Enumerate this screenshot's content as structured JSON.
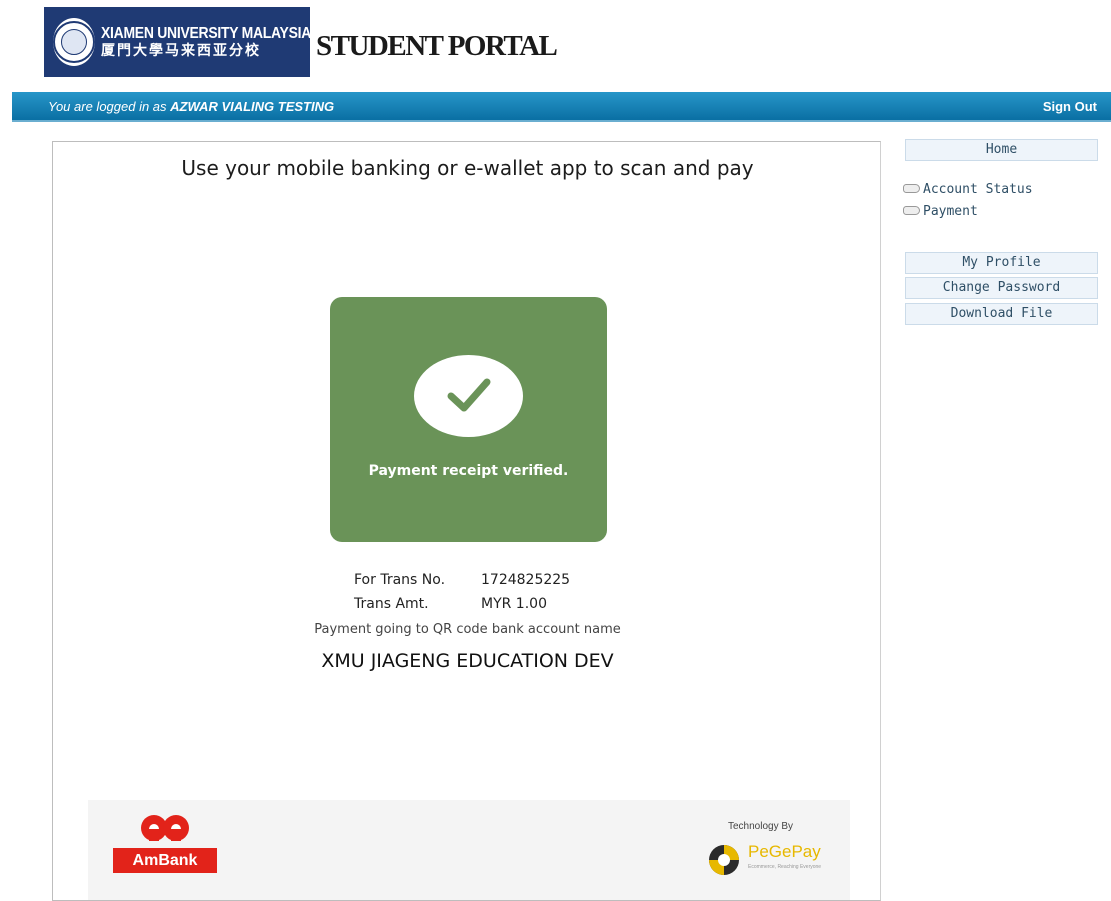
{
  "header": {
    "logo_en": "XIAMEN UNIVERSITY MALAYSIA",
    "logo_cn": "厦門大學马来西亚分校",
    "portal_title": "STUDENT PORTAL"
  },
  "topbar": {
    "login_prefix": "You are logged in as",
    "user_name": "AZWAR VIALING TESTING",
    "sign_out": "Sign Out"
  },
  "payment": {
    "heading": "Use your mobile banking or e-wallet app to scan and pay",
    "status_text": "Payment receipt verified.",
    "trans_no_label": "For Trans No.",
    "trans_no": "1724825225",
    "trans_amt_label": "Trans Amt.",
    "trans_amt": "MYR 1.00",
    "going_to_text": "Payment going to QR code bank account name",
    "account_name": "XMU JIAGENG EDUCATION DEV",
    "status_color": "#6a9358"
  },
  "footer": {
    "bank_name": "AmBank",
    "tech_by": "Technology By",
    "provider_name": "PeGePay",
    "provider_tagline": "Ecommerce, Reaching Everyone"
  },
  "sidebar": {
    "home": "Home",
    "links": [
      "Account Status",
      "Payment"
    ],
    "buttons": [
      "My Profile",
      "Change Password",
      "Download File"
    ]
  },
  "colors": {
    "brand_navy": "#1f3a74",
    "topbar_blue": "#1a82b8",
    "ambank_red": "#e2231a",
    "pegepay_yellow": "#e7b800"
  }
}
